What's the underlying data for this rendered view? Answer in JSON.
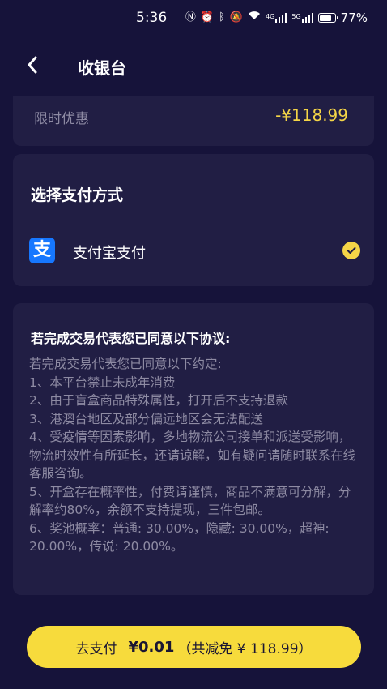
{
  "status_bar": {
    "time": "5:36",
    "icons": [
      "nfc-icon",
      "alarm-icon",
      "bluetooth-icon",
      "mute-icon",
      "wifi-icon",
      "signal-4g-icon",
      "signal-5g-icon",
      "battery-icon"
    ],
    "network_a": "4G",
    "network_b": "5G",
    "battery": "77%"
  },
  "nav": {
    "title": "收银台"
  },
  "discount": {
    "label": "限时优惠",
    "value": "-¥118.99"
  },
  "payment": {
    "title": "选择支付方式",
    "option_label": "支付宝支付",
    "logo_glyph": "支",
    "selected": true
  },
  "terms": {
    "title": "若完成交易代表您已同意以下协议:",
    "lines": [
      "若完成交易代表您已同意以下约定:",
      "1、本平台禁止未成年消费",
      "2、由于盲盒商品特殊属性，打开后不支持退款",
      "3、港澳台地区及部分偏远地区会无法配送",
      "4、受疫情等因素影响，多地物流公司接单和派送受影响，物流时效性有所延长，还请谅解，如有疑问请随时联系在线客服咨询。",
      "5、开盒存在概率性，付费请谨慎，商品不满意可分解，分解率约80%，余额不支持提现，三件包邮。",
      "6、奖池概率：普通: 30.00%，隐藏: 30.00%，超神: 20.00%，传说: 20.00%。"
    ]
  },
  "pay_button": {
    "label": "去支付",
    "amount": "¥0.01",
    "saving": "（共减免 ¥ 118.99）"
  },
  "colors": {
    "background": "#16133a",
    "card": "#211e44",
    "accent": "#f7db3c",
    "alipay": "#1677ff",
    "muted_text": "#8e8ba3"
  }
}
